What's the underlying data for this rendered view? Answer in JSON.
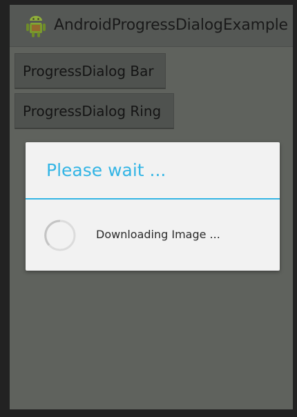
{
  "app": {
    "title": "AndroidProgressDialogExample",
    "icon": "android-robot-icon"
  },
  "buttons": {
    "bar_label": "ProgressDialog Bar",
    "ring_label": "ProgressDialog Ring"
  },
  "dialog": {
    "title": "Please wait ...",
    "message": "Downloading Image ...",
    "spinner_icon": "progress-ring-icon"
  },
  "colors": {
    "accent": "#33b5e5",
    "background": "#5f625d",
    "dialog_background": "#f2f2f2"
  }
}
